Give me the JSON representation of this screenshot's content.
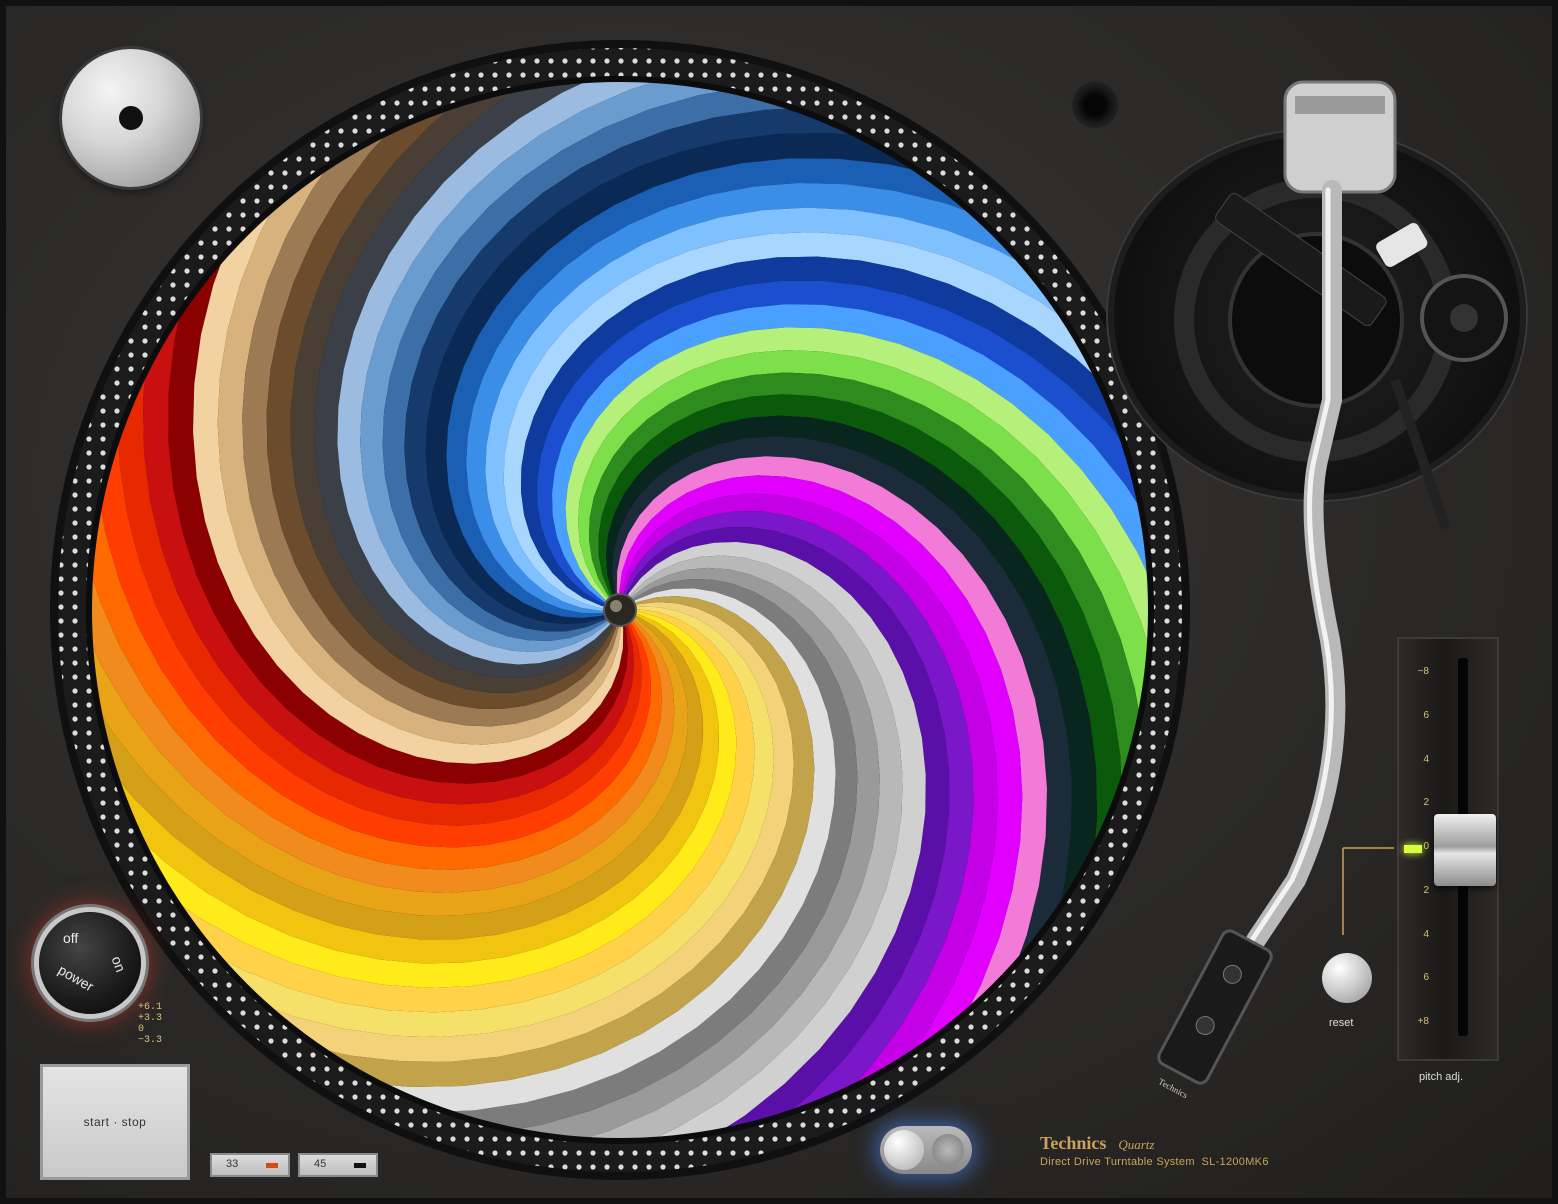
{
  "device": {
    "brand": "Technics",
    "brand_suffix": "Quartz",
    "description": "Direct Drive Turntable System",
    "model": "SL-1200MK6"
  },
  "controls": {
    "start_stop_label": "start · stop",
    "speed_33_label": "33",
    "speed_45_label": "45",
    "power_label": "power",
    "power_off_label": "off",
    "power_on_label": "on",
    "reset_label": "reset",
    "pitch_label": "pitch adj.",
    "pitch_scale": [
      "−8",
      "6",
      "4",
      "2",
      "0",
      "2",
      "4",
      "6",
      "+8"
    ],
    "pitch_value_percent": 0
  },
  "pitch_marks": [
    "+6.1",
    "+3.3",
    "0",
    "−3.3"
  ],
  "headshell_label": "Technics",
  "colors": {
    "speed_33_led": "#d14a1a",
    "speed_45_led": "#111111",
    "pitch_led": "#d9ff3a",
    "slipmat_palette": [
      "#ffeb1a",
      "#f1c40f",
      "#d4a017",
      "#e8a317",
      "#f28b1e",
      "#ff6a00",
      "#ff3d00",
      "#e82800",
      "#c81010",
      "#8b0000",
      "#f2d2a0",
      "#d8b27c",
      "#9c7a54",
      "#6b4d2e",
      "#4a3f35",
      "#3a3f48",
      "#9bbce0",
      "#6a9cd0",
      "#3c6ea8",
      "#153a6b",
      "#0a2a55",
      "#1a5fb4",
      "#3b8ee8",
      "#7fc0ff",
      "#a9d6ff",
      "#0f3a9e",
      "#1b4fd0",
      "#4aa0ff",
      "#b5f07a",
      "#7be04a",
      "#2e8b1e",
      "#0b5a0b",
      "#08261e",
      "#1c2b3a",
      "#f37bd8",
      "#e100ff",
      "#c300e6",
      "#7a18c9",
      "#5a0fa8",
      "#d0d0d0",
      "#b8b8b8",
      "#9a9a9a",
      "#7c7c7c",
      "#e0e0e0",
      "#c2a24a",
      "#f4d27a",
      "#f5e06a",
      "#ffd24a"
    ]
  }
}
